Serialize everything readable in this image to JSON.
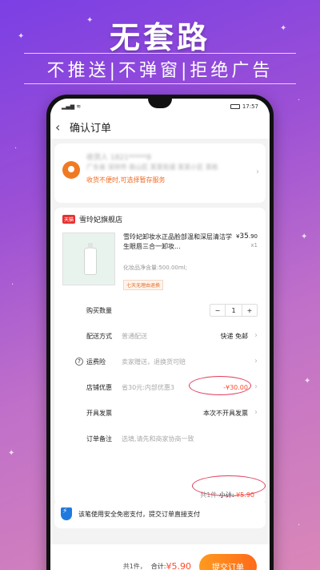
{
  "promo": {
    "title": "无套路",
    "subtitle": "不推送|不弹窗|拒绝广告"
  },
  "status_bar": {
    "time": "17:57"
  },
  "header": {
    "title": "确认订单"
  },
  "address": {
    "name_blurred": "收货人 1821*****8",
    "detail_blurred": "广东省 深圳市 南山区 某某街道 某某小区 某栋",
    "note": "收货不便时,可选择暂存服务"
  },
  "shop": {
    "badge": "天猫",
    "name": "雪玲妃旗舰店",
    "product": {
      "title": "雪玲妃卸妆水正品脸部温和深层清洁学生眼唇三合一卸妆...",
      "spec": "化妆品净含量:500.00ml;",
      "tag": "七天无理由退换",
      "price_symbol": "¥",
      "price_int": "35",
      "price_dec": ".90",
      "qty": "x1"
    },
    "rows": {
      "quantity_label": "购买数量",
      "quantity_minus": "−",
      "quantity_value": "1",
      "quantity_plus": "+",
      "delivery_label": "配送方式",
      "delivery_value": "普通配送",
      "delivery_right": "快递 免邮",
      "insurance_label": "运费险",
      "insurance_value": "卖家赠送，退换货可赔",
      "discount_label": "店铺优惠",
      "discount_value": "省30元:内部优惠3",
      "discount_amount": "-¥30.00",
      "invoice_label": "开具发票",
      "invoice_right": "本次不开具发票",
      "remark_label": "订单备注",
      "remark_placeholder": "选填,请先和商家协商一致"
    },
    "subtotal": {
      "count": "共1件",
      "label": "小计:",
      "price": "¥5.90"
    }
  },
  "safety": {
    "text": "该笔使用安全免密支付，提交订单直接支付"
  },
  "bottom": {
    "count": "共1件，",
    "total_label": "合计:",
    "total_price": "¥5.90",
    "submit": "提交订单"
  },
  "colors": {
    "accent": "#ff6a1a",
    "price": "#ff4b2b",
    "highlight_oval": "#e23a5a"
  }
}
